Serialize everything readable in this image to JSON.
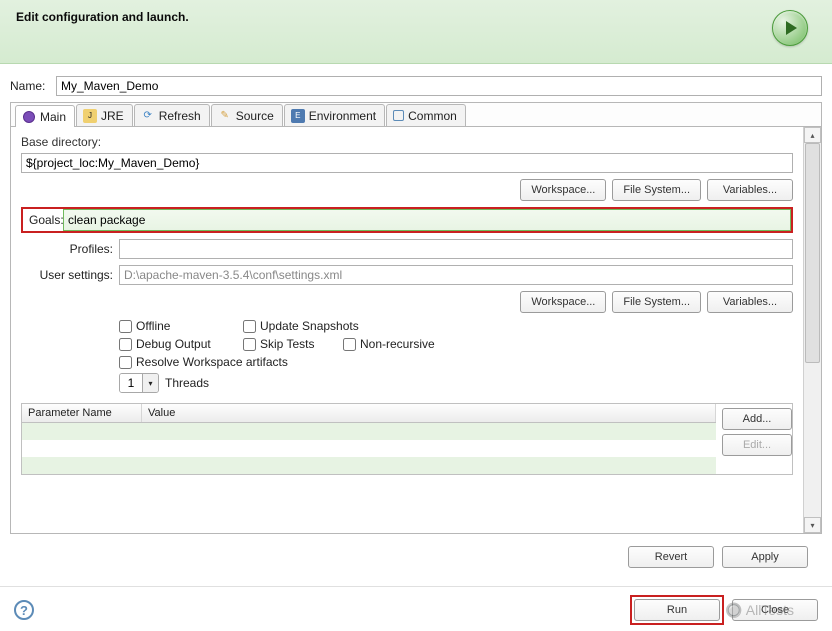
{
  "header": {
    "title": "Edit configuration and launch."
  },
  "name_field": {
    "label": "Name:",
    "value": "My_Maven_Demo"
  },
  "tabs": [
    {
      "label": "Main",
      "icon": "purple"
    },
    {
      "label": "JRE",
      "icon": "jre"
    },
    {
      "label": "Refresh",
      "icon": "refresh"
    },
    {
      "label": "Source",
      "icon": "source"
    },
    {
      "label": "Environment",
      "icon": "env"
    },
    {
      "label": "Common",
      "icon": "common"
    }
  ],
  "base_dir": {
    "label": "Base directory:",
    "value": "${project_loc:My_Maven_Demo}",
    "buttons": {
      "workspace": "Workspace...",
      "filesystem": "File System...",
      "variables": "Variables..."
    }
  },
  "goals": {
    "label": "Goals:",
    "value": "clean package"
  },
  "profiles": {
    "label": "Profiles:",
    "value": ""
  },
  "user_settings": {
    "label": "User settings:",
    "value": "D:\\apache-maven-3.5.4\\conf\\settings.xml",
    "buttons": {
      "workspace": "Workspace...",
      "filesystem": "File System...",
      "variables": "Variables..."
    }
  },
  "checkboxes": {
    "offline": "Offline",
    "update_snapshots": "Update Snapshots",
    "debug_output": "Debug Output",
    "skip_tests": "Skip Tests",
    "non_recursive": "Non-recursive",
    "resolve_workspace": "Resolve Workspace artifacts"
  },
  "threads": {
    "value": "1",
    "label": "Threads"
  },
  "params_table": {
    "col1": "Parameter Name",
    "col2": "Value",
    "add": "Add...",
    "edit": "Edit..."
  },
  "bottom": {
    "revert": "Revert",
    "apply": "Apply"
  },
  "footer": {
    "run": "Run",
    "close": "Close"
  }
}
